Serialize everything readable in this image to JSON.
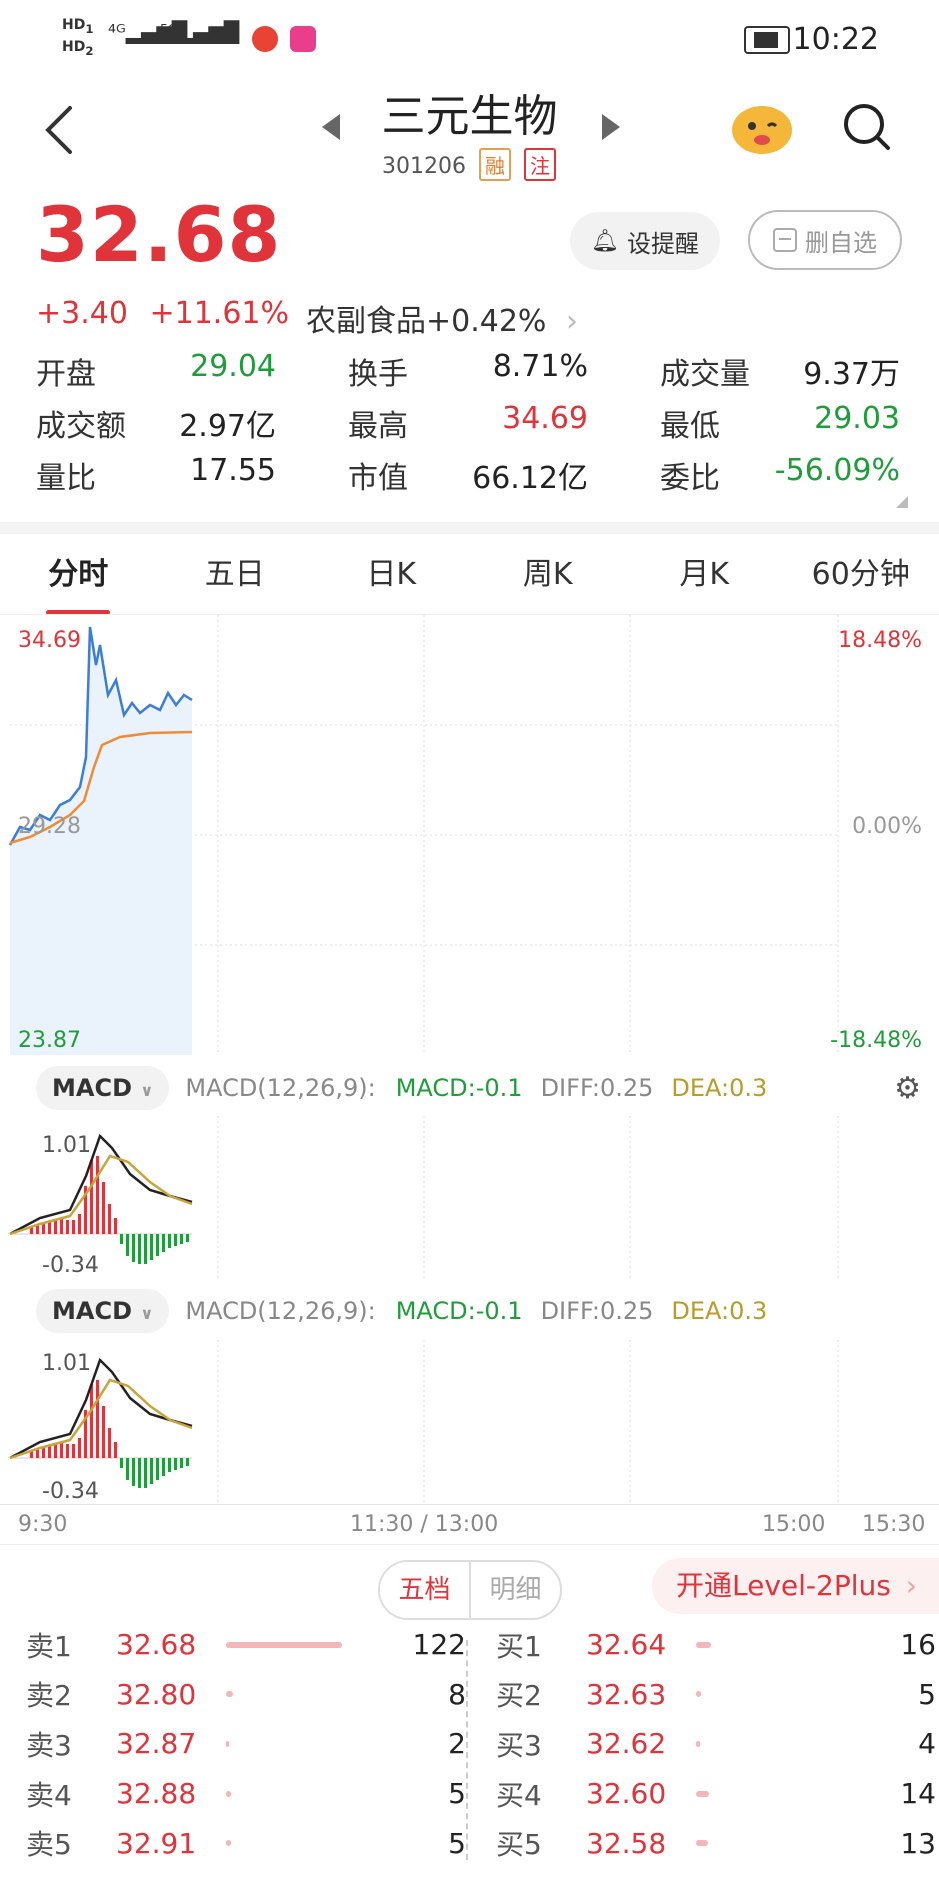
{
  "status": {
    "time": "10:22",
    "left_icons": [
      "HD1",
      "HD2",
      "4G",
      "5G",
      "wifi",
      "weibo",
      "video-app"
    ],
    "battery": "charging"
  },
  "header": {
    "title": "三元生物",
    "code": "301206",
    "tag1": "融",
    "tag2": "注"
  },
  "quote": {
    "price": "32.68",
    "change": "+3.40",
    "change_pct": "+11.61%",
    "sector": "农副食品",
    "sector_pct": "+0.42%",
    "remind_label": "设提醒",
    "del_label": "删自选"
  },
  "stats": [
    [
      {
        "label": "开盘",
        "value": "29.04",
        "color": "green"
      },
      {
        "label": "换手",
        "value": "8.71%",
        "color": "black"
      },
      {
        "label": "成交量",
        "value": "9.37万",
        "color": "black"
      }
    ],
    [
      {
        "label": "成交额",
        "value": "2.97亿",
        "color": "black"
      },
      {
        "label": "最高",
        "value": "34.69",
        "color": "red"
      },
      {
        "label": "最低",
        "value": "29.03",
        "color": "green"
      }
    ],
    [
      {
        "label": "量比",
        "value": "17.55",
        "color": "black"
      },
      {
        "label": "市值",
        "value": "66.12亿",
        "color": "black"
      },
      {
        "label": "委比",
        "value": "-56.09%",
        "color": "green"
      }
    ]
  ],
  "tabs": [
    "分时",
    "五日",
    "日K",
    "周K",
    "月K",
    "60分钟"
  ],
  "chart": {
    "price_high": "34.69",
    "price_mid": "29.28",
    "price_low": "23.87",
    "pct_high": "18.48%",
    "pct_mid": "0.00%",
    "pct_low": "-18.48%",
    "macd_high": "1.01",
    "macd_low": "-0.34",
    "time_labels": [
      "9:30",
      "11:30 / 13:00",
      "15:00",
      "15:30"
    ]
  },
  "indicator": {
    "name": "MACD",
    "params": "MACD(12,26,9):",
    "macd": "MACD:-0.1",
    "diff": "DIFF:0.25",
    "dea": "DEA:0.3"
  },
  "orderbook": {
    "tab_active": "五档",
    "tab_other": "明细",
    "level2": "开通Level-2Plus",
    "sell": [
      {
        "label": "卖1",
        "price": "32.68",
        "vol": "122",
        "bar": 0.98
      },
      {
        "label": "卖2",
        "price": "32.80",
        "vol": "8",
        "bar": 0.06
      },
      {
        "label": "卖3",
        "price": "32.87",
        "vol": "2",
        "bar": 0.02
      },
      {
        "label": "卖4",
        "price": "32.88",
        "vol": "5",
        "bar": 0.04
      },
      {
        "label": "卖5",
        "price": "32.91",
        "vol": "5",
        "bar": 0.04
      }
    ],
    "buy": [
      {
        "label": "买1",
        "price": "32.64",
        "vol": "16",
        "bar": 0.13
      },
      {
        "label": "买2",
        "price": "32.63",
        "vol": "5",
        "bar": 0.04
      },
      {
        "label": "买3",
        "price": "32.62",
        "vol": "4",
        "bar": 0.03
      },
      {
        "label": "买4",
        "price": "32.60",
        "vol": "14",
        "bar": 0.11
      },
      {
        "label": "买5",
        "price": "32.58",
        "vol": "13",
        "bar": 0.1
      }
    ]
  }
}
